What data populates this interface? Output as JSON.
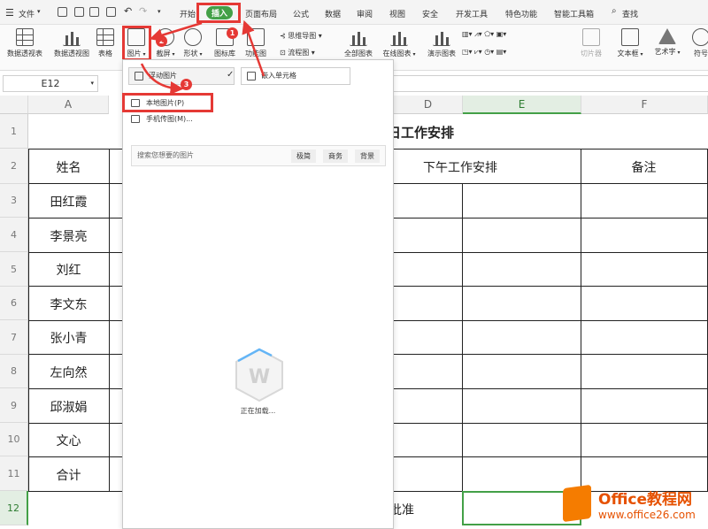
{
  "menubar": {
    "file_label": "文件",
    "tabs": [
      "开始",
      "插入",
      "页面布局",
      "公式",
      "数据",
      "审阅",
      "视图",
      "安全",
      "开发工具",
      "特色功能",
      "智能工具箱"
    ],
    "active_tab": "插入",
    "search_label": "查找"
  },
  "ribbon": {
    "pivot_table": "数据透视表",
    "pivot_chart": "数据透视图",
    "table": "表格",
    "picture": "图片",
    "screenshot": "截屏",
    "shapes": "形状",
    "icon_lib": "图标库",
    "function_chart": "功能图",
    "mindmap": "思维导图",
    "flowchart": "流程图",
    "all_charts": "全部图表",
    "online_charts": "在线图表",
    "demo_charts": "演示图表",
    "slicer": "切片器",
    "textbox": "文本框",
    "wordart": "艺术字",
    "symbol": "符号"
  },
  "namebox": {
    "value": "E12"
  },
  "sheet": {
    "columns": [
      "A",
      "D",
      "E",
      "F"
    ],
    "selected_column": "E",
    "rows": [
      "1",
      "2",
      "3",
      "4",
      "5",
      "6",
      "7",
      "8",
      "9",
      "10",
      "11",
      "12"
    ],
    "selected_row": "12",
    "title_fragment": "日工作安排",
    "header_name": "姓名",
    "header_afternoon": "下午工作安排",
    "header_note": "备注",
    "names": [
      "田红霞",
      "李景亮",
      "刘红",
      "李文东",
      "张小青",
      "左向然",
      "邱淑娟",
      "文心",
      "合计"
    ],
    "approval_fragment": "批准"
  },
  "picture_menu": {
    "tab_floating": "浮动图片",
    "tab_embedded": "嵌入单元格",
    "local_picture": "本地图片(P)",
    "phone_picture": "手机传图(M)...",
    "search_placeholder": "搜索您想要的图片",
    "chips": [
      "极简",
      "商务",
      "背景"
    ],
    "loading": "正在加载..."
  },
  "annotations": {
    "step1": "1",
    "step2": "2",
    "step3": "3",
    "accent": "#e53935"
  },
  "watermark": {
    "brand": "Office教程网",
    "url": "www.office26.com"
  }
}
